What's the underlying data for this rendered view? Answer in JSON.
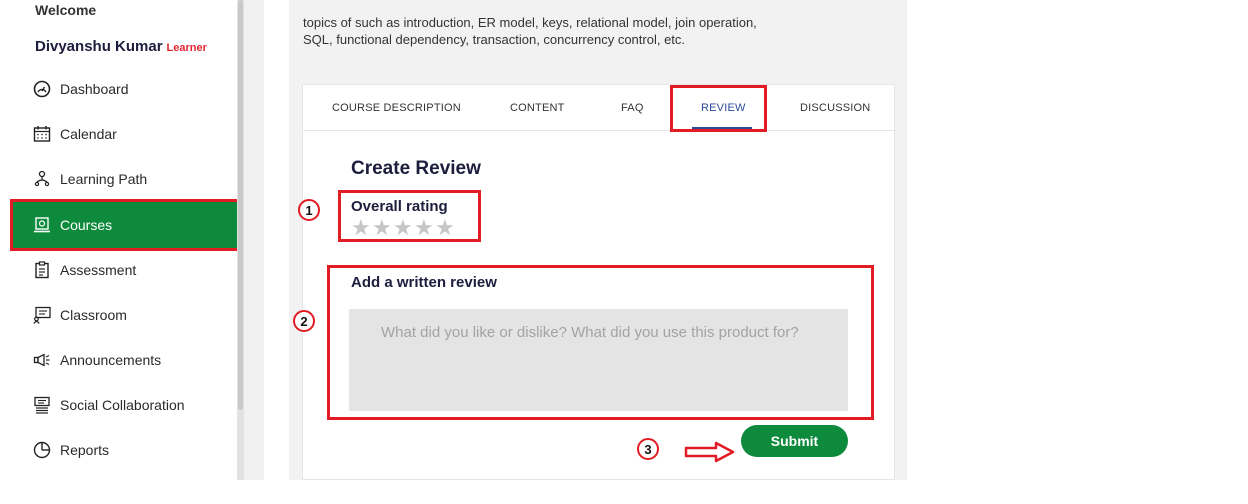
{
  "sidebar": {
    "welcome": "Welcome",
    "user_name": "Divyanshu Kumar",
    "user_role": "Learner",
    "items": [
      {
        "label": "Dashboard",
        "icon": "dashboard-icon"
      },
      {
        "label": "Calendar",
        "icon": "calendar-icon"
      },
      {
        "label": "Learning Path",
        "icon": "learning-path-icon"
      },
      {
        "label": "Courses",
        "icon": "courses-icon",
        "active": true
      },
      {
        "label": "Assessment",
        "icon": "assessment-icon"
      },
      {
        "label": "Classroom",
        "icon": "classroom-icon"
      },
      {
        "label": "Announcements",
        "icon": "announcements-icon"
      },
      {
        "label": "Social Collaboration",
        "icon": "social-collaboration-icon"
      },
      {
        "label": "Reports",
        "icon": "reports-icon"
      }
    ]
  },
  "course": {
    "description": "topics of such as introduction, ER model, keys, relational model, join operation, SQL, functional dependency, transaction, concurrency control, etc."
  },
  "tabs": [
    {
      "label": "COURSE DESCRIPTION"
    },
    {
      "label": "CONTENT"
    },
    {
      "label": "FAQ"
    },
    {
      "label": "REVIEW",
      "active": true
    },
    {
      "label": "DISCUSSION"
    }
  ],
  "review": {
    "heading": "Create Review",
    "rating_label": "Overall rating",
    "rating_value": 0,
    "rating_max": 5,
    "written_label": "Add a written review",
    "placeholder": "What did you like or dislike? What did you use this product for?",
    "submit_label": "Submit"
  },
  "annotations": {
    "step1": "1",
    "step2": "2",
    "step3": "3"
  },
  "colors": {
    "accent_green": "#0e8a3c",
    "highlight_red": "#e11c24",
    "tab_active": "#2c4a9a"
  }
}
